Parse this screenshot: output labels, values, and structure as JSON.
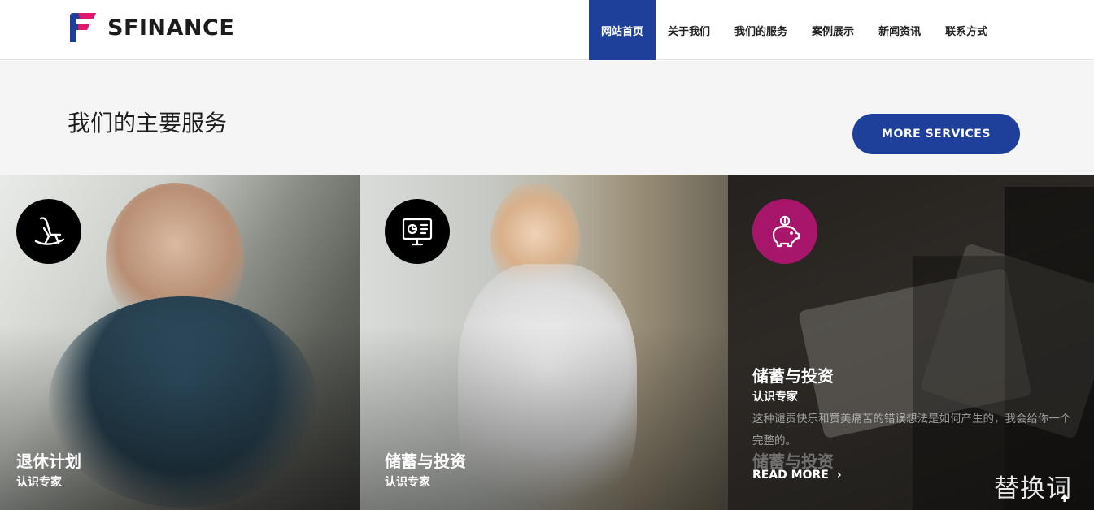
{
  "brand": {
    "name": "SFINANCE",
    "accent": "#1e3f9a",
    "logo_colors": [
      "#1e3f9a",
      "#e2186f"
    ]
  },
  "nav": {
    "items": [
      {
        "label": "网站首页",
        "active": true
      },
      {
        "label": "关于我们",
        "active": false
      },
      {
        "label": "我们的服务",
        "active": false
      },
      {
        "label": "案例展示",
        "active": false
      },
      {
        "label": "新闻资讯",
        "active": false
      },
      {
        "label": "联系方式",
        "active": false
      }
    ]
  },
  "services": {
    "heading": "我们的主要服务",
    "more_button": "MORE SERVICES",
    "cards": [
      {
        "title": "退休计划",
        "subtitle": "认识专家",
        "icon": "rocking-chair-icon"
      },
      {
        "title": "储蓄与投资",
        "subtitle": "认识专家",
        "icon": "computer-chart-icon"
      },
      {
        "title": "储蓄与投资",
        "subtitle": "认识专家",
        "description": "这种谴责快乐和赞美痛苦的错误想法是如何产生的，我会给你一个完整的。",
        "read_more": "READ MORE",
        "icon": "piggy-bank-icon",
        "icon_color": "#a8166b"
      }
    ]
  },
  "watermark": "替换词",
  "back_to_top": "arrow-up-icon"
}
